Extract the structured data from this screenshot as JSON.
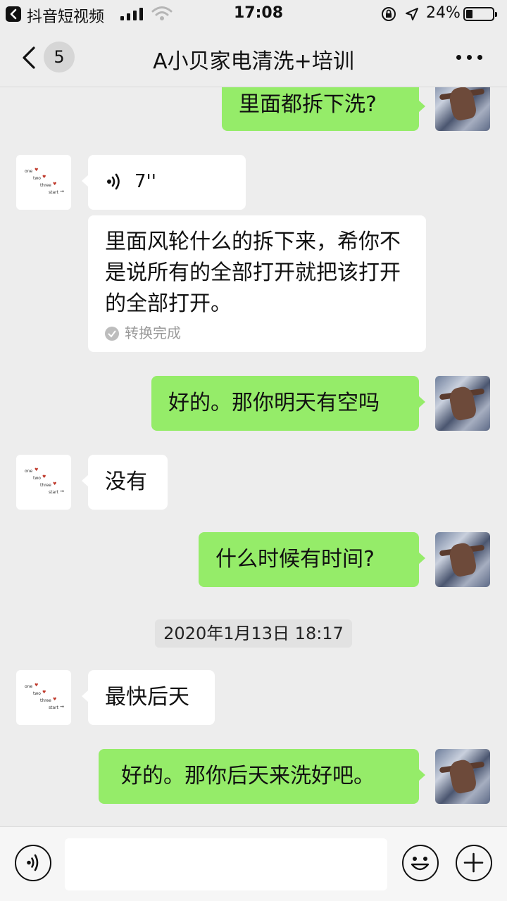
{
  "status_bar": {
    "back_app": "抖音短视频",
    "time": "17:08",
    "battery": "24%",
    "battery_level": 0.24
  },
  "nav": {
    "unread_count": "5",
    "title": "A小贝家电清洗+培训"
  },
  "messages": [
    {
      "from": "me",
      "text": "里面都拆下洗?"
    },
    {
      "from": "them",
      "type": "voice",
      "duration": "7''"
    },
    {
      "from": "them",
      "type": "transcript",
      "text": "里面风轮什么的拆下来，希你不是说所有的全部打开就把该打开的全部打开。",
      "status": "转换完成"
    },
    {
      "from": "me",
      "text": "好的。那你明天有空吗"
    },
    {
      "from": "them",
      "text": "没有"
    },
    {
      "from": "me",
      "text": "什么时候有时间?"
    },
    {
      "type": "timestamp",
      "text": "2020年1月13日 18:17"
    },
    {
      "from": "them",
      "text": "最快后天"
    },
    {
      "from": "me",
      "text": "好的。那你后天来洗好吧。"
    }
  ],
  "contact_avatar_text": [
    "one",
    "two",
    "three",
    "start"
  ],
  "colors": {
    "my_bubble": "#95ec69",
    "their_bubble": "#ffffff",
    "background": "#ededed"
  }
}
